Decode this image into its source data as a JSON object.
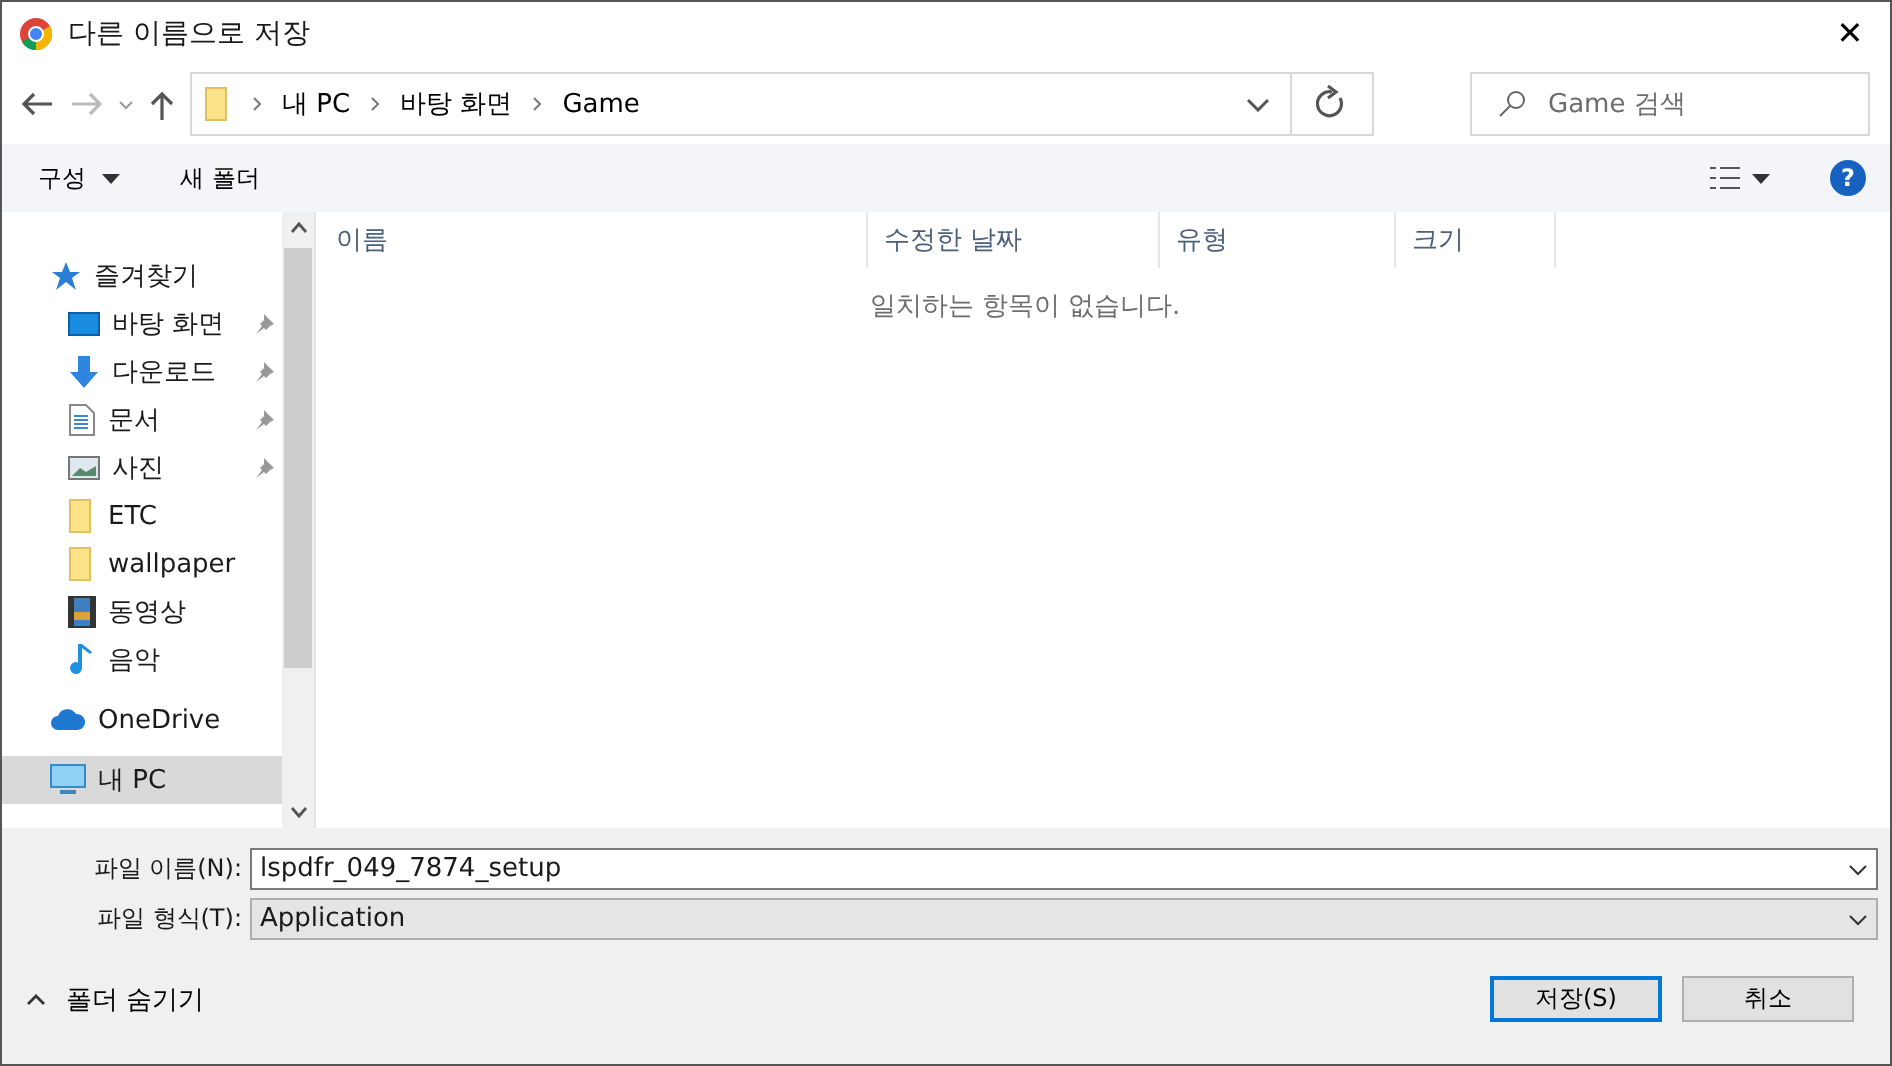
{
  "window": {
    "title": "다른 이름으로 저장",
    "close": "✕"
  },
  "breadcrumb": [
    "내 PC",
    "바탕 화면",
    "Game"
  ],
  "search": {
    "placeholder": "Game 검색"
  },
  "toolbar": {
    "organize": "구성",
    "new_folder": "새 폴더",
    "help": "?"
  },
  "sidebar": {
    "items": [
      {
        "label": "즐겨찾기",
        "kind": "star",
        "pinned": false,
        "selected": false,
        "group": true
      },
      {
        "label": "바탕 화면",
        "kind": "desktop",
        "pinned": true,
        "selected": false,
        "group": false
      },
      {
        "label": "다운로드",
        "kind": "download",
        "pinned": true,
        "selected": false,
        "group": false
      },
      {
        "label": "문서",
        "kind": "document",
        "pinned": true,
        "selected": false,
        "group": false
      },
      {
        "label": "사진",
        "kind": "pictures",
        "pinned": true,
        "selected": false,
        "group": false
      },
      {
        "label": "ETC",
        "kind": "folder",
        "pinned": false,
        "selected": false,
        "group": false
      },
      {
        "label": "wallpaper",
        "kind": "folder",
        "pinned": false,
        "selected": false,
        "group": false
      },
      {
        "label": "동영상",
        "kind": "video",
        "pinned": false,
        "selected": false,
        "group": false
      },
      {
        "label": "음악",
        "kind": "music",
        "pinned": false,
        "selected": false,
        "group": false
      },
      {
        "label": "OneDrive",
        "kind": "cloud",
        "pinned": false,
        "selected": false,
        "group": true
      },
      {
        "label": "내 PC",
        "kind": "pc",
        "pinned": false,
        "selected": true,
        "group": true
      }
    ]
  },
  "table": {
    "columns": [
      "이름",
      "수정한 날짜",
      "유형",
      "크기"
    ],
    "empty_message": "일치하는 항목이 없습니다."
  },
  "form": {
    "file_name_label": "파일 이름(N):",
    "file_name": "lspdfr_049_7874_setup",
    "file_type_label": "파일 형식(T):",
    "file_type": "Application"
  },
  "hide_folders": "폴더 숨기기",
  "buttons": [
    "저장(S)",
    "취소"
  ]
}
